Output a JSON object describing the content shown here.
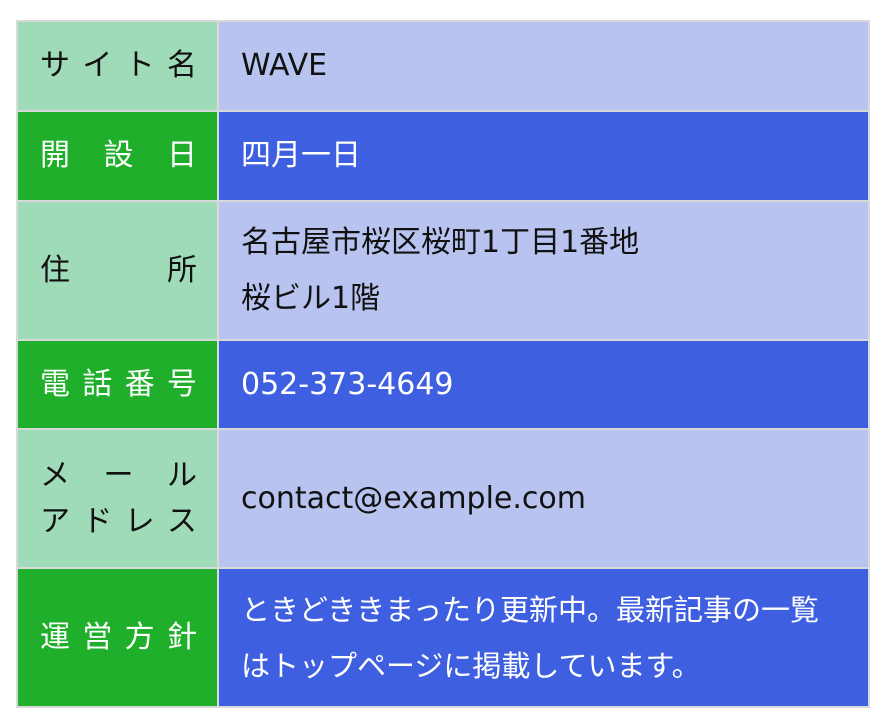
{
  "rows": [
    {
      "label_lines": [
        "サイト名"
      ],
      "value_lines": [
        "WAVE"
      ]
    },
    {
      "label_lines": [
        "開設日"
      ],
      "value_lines": [
        "四月一日"
      ]
    },
    {
      "label_lines": [
        "住所"
      ],
      "value_lines": [
        "名古屋市桜区桜町1丁目1番地",
        "桜ビル1階"
      ]
    },
    {
      "label_lines": [
        "電話番号"
      ],
      "value_lines": [
        "052-373-4649"
      ]
    },
    {
      "label_lines": [
        "メール",
        "アドレス"
      ],
      "value_lines": [
        "contact@example.com"
      ]
    },
    {
      "label_lines": [
        "運営方針"
      ],
      "value_lines": [
        "ときどききまったり更新中。最新記事の一覧",
        "はトップページに掲載しています。"
      ]
    }
  ],
  "colors": {
    "label_light": "#9fdbb9",
    "value_light": "#b8c3f0",
    "label_dark": "#1faf2a",
    "value_dark": "#3d5fe0",
    "border": "#d9d9d9"
  }
}
